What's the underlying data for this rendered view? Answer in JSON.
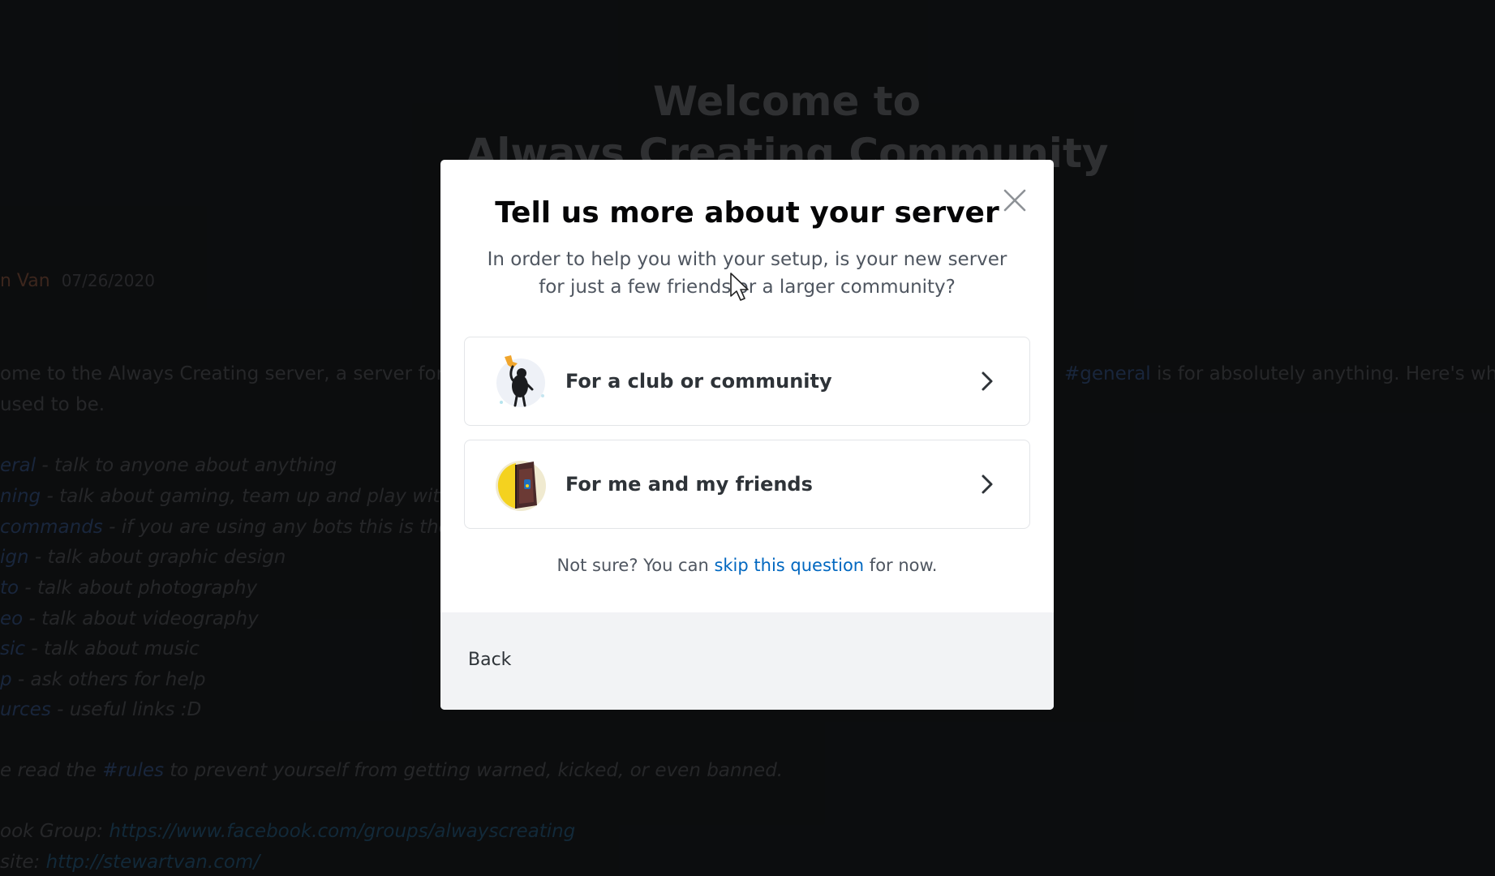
{
  "background": {
    "title_line1": "Welcome to",
    "title_line2": "Always Creating Community",
    "author": "n Van",
    "timestamp": "07/26/2020",
    "intro_left": "ome to the Always Creating server, a server for c",
    "intro_right_channel": "#general",
    "intro_right_text": " is for absolutely anything. Here's wha",
    "intro_line2": "used to be.",
    "channels": [
      {
        "ch": "eral",
        "desc": " - talk to anyone about anything"
      },
      {
        "ch": "ning",
        "desc": " - talk about gaming, team up and play with"
      },
      {
        "ch": "commands",
        "desc": " - if you are using any bots this is the"
      },
      {
        "ch": "ign",
        "desc": " - talk about graphic design"
      },
      {
        "ch": "to",
        "desc": " - talk about photography"
      },
      {
        "ch": "eo",
        "desc": " -  talk about videography"
      },
      {
        "ch": "sic",
        "desc": " - talk about music"
      },
      {
        "ch": "p",
        "desc": " - ask others for help"
      },
      {
        "ch": "urces",
        "desc": " - useful links :D"
      }
    ],
    "rules_prefix": "e read the ",
    "rules_channel": "#rules",
    "rules_suffix": " to prevent yourself from getting warned, kicked, or even banned.",
    "fb_prefix": "ook Group: ",
    "fb_link": "https://www.facebook.com/groups/alwayscreating",
    "site_prefix": "site: ",
    "site_link": "http://stewartvan.com/"
  },
  "modal": {
    "title": "Tell us more about your server",
    "subtitle": "In order to help you with your setup, is your new server for just a few friends or a larger community?",
    "options": [
      {
        "label": "For a club or community",
        "icon": "community-illustration"
      },
      {
        "label": "For me and my friends",
        "icon": "friends-illustration"
      }
    ],
    "hint_prefix": "Not sure? You can ",
    "hint_link": "skip this question",
    "hint_suffix": " for now.",
    "back_label": "Back"
  },
  "colors": {
    "link": "#0067c0",
    "footer_bg": "#f2f3f5",
    "page_bg": "#0f1012"
  }
}
